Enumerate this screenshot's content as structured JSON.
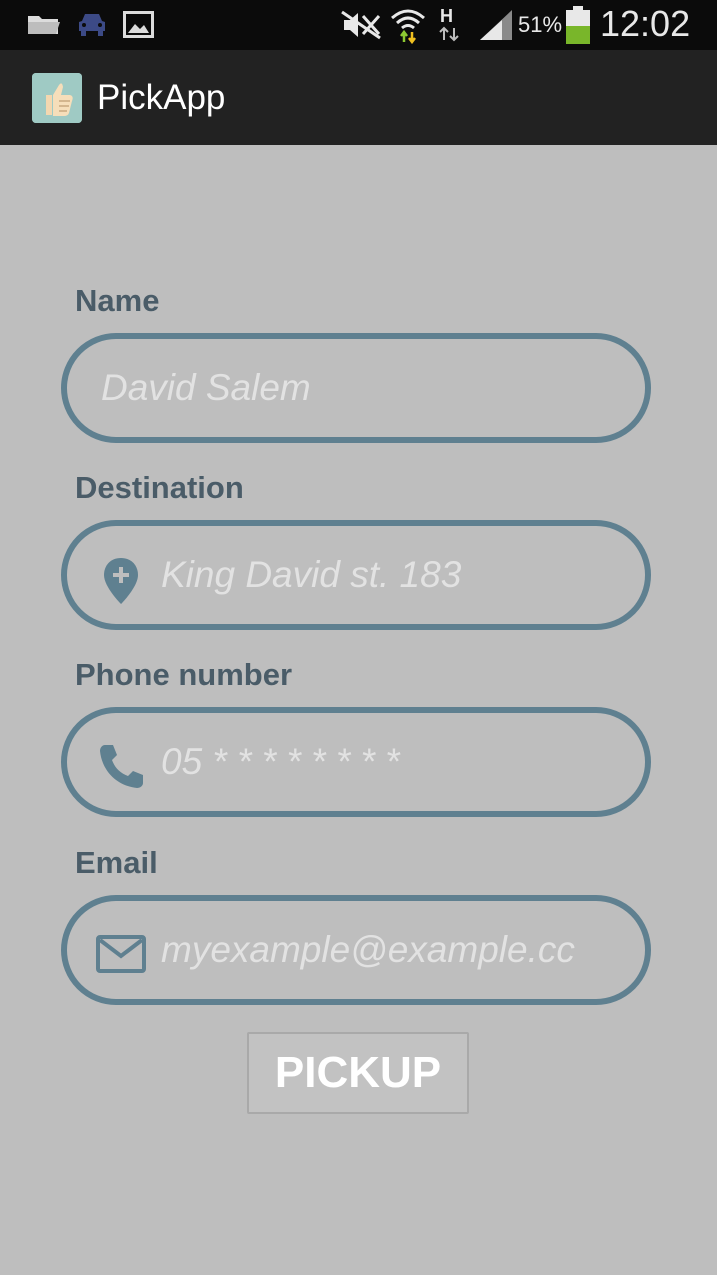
{
  "status_bar": {
    "battery": "51%",
    "time": "12:02",
    "network_type": "H",
    "icons": [
      "folder-icon",
      "car-icon",
      "image-icon",
      "mute-icon",
      "wifi-icon",
      "network-h-icon",
      "signal-icon",
      "battery-icon"
    ]
  },
  "app_bar": {
    "title": "PickApp",
    "icon": "thumbs-up-icon"
  },
  "form": {
    "name_label": "Name",
    "name_placeholder": "David Salem",
    "destination_label": "Destination",
    "destination_placeholder": "King David st. 183",
    "destination_icon": "location-pin-icon",
    "phone_label": "Phone number",
    "phone_placeholder": "05 * * * * * * * *",
    "phone_icon": "phone-icon",
    "email_label": "Email",
    "email_placeholder": "myexample@example.cc",
    "email_icon": "mail-icon",
    "submit_label": "PICKUP"
  },
  "colors": {
    "background": "#bebebe",
    "status_bar": "#0b0b0b",
    "app_bar": "#222222",
    "label": "#4a5c68",
    "field_border": "#5f8090",
    "placeholder": "#e2e2e2"
  }
}
